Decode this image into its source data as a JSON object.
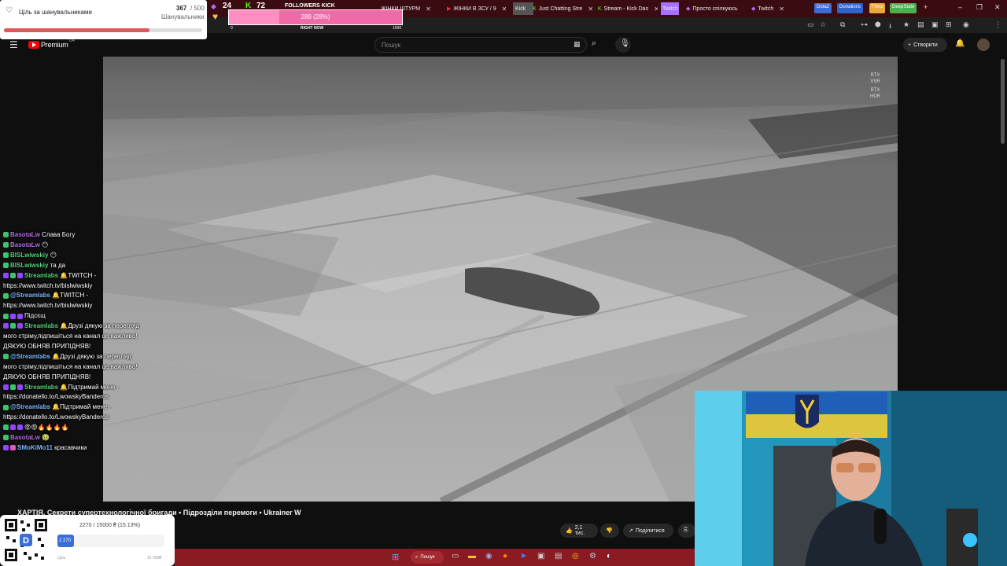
{
  "browser": {
    "tabs": [
      {
        "label": "ЖІНКИ ШТУРМ"
      },
      {
        "label": "ЖІНКИ В ЗСУ / 9"
      },
      {
        "label": "Kick"
      },
      {
        "label": "Just Chatting Stre"
      },
      {
        "label": "Stream - Kick Das"
      },
      {
        "label": "Twitch"
      },
      {
        "label": "Просто спілкуюсь"
      },
      {
        "label": "Twitch"
      }
    ],
    "bookmarks": [
      {
        "label": "Dota2",
        "color": "#3b6ed4"
      },
      {
        "label": "Donations",
        "color": "#2f63c9"
      },
      {
        "label": "Films",
        "color": "#e8a83a"
      },
      {
        "label": "DeepState",
        "color": "#4caf50"
      }
    ],
    "window_controls": [
      "–",
      "❐",
      "✕"
    ],
    "new_tab": "+"
  },
  "youtube": {
    "logo_text": "Premium",
    "logo_sup": "UA",
    "search_placeholder": "Пошук",
    "create_label": "Створити",
    "video_title": "ХАРТІЯ. Секрети супертехнологічної бригади • Підрозділи перемоги • Ukrainer W",
    "likes": "2,1 тис.",
    "share_label": "Поділитися",
    "video_badges": [
      "RTX",
      "VSR",
      "RTX",
      "HDR"
    ]
  },
  "overlays": {
    "goal_title": "Ціль за шанувальниками",
    "goal_count": "367",
    "goal_total": "/ 500",
    "goal_sub": "Шанувальники",
    "goal_fraction": 0.734,
    "stat1": "24",
    "stat2": "72",
    "followers_title": "FOLLOWERS KICK",
    "followers_progress": "289 (28%)",
    "followers_fraction": 0.289,
    "followers_left": "0",
    "followers_mid": "RIGHT NOW",
    "followers_right": "1000",
    "donate_text": "2270 / 15000 ₴ (15.13%)",
    "donate_bar_label": "2 270",
    "donate_fraction": 0.1513,
    "donate_left": "Ціль",
    "donate_right": "15 000₴"
  },
  "chat": [
    {
      "nick": "BasotaLw",
      "nick_class": "nick-p",
      "text": "Слава Богу",
      "badges": [
        "#3ec46d"
      ]
    },
    {
      "nick": "BasotaLw",
      "nick_class": "nick-p",
      "text": "😶",
      "badges": [
        "#3ec46d"
      ]
    },
    {
      "nick": "BISLwiwskiy",
      "nick_class": "nick-g",
      "text": "😶",
      "badges": [
        "#3ec46d"
      ]
    },
    {
      "nick": "BISLwiwskiy",
      "nick_class": "nick-g",
      "text": "та да",
      "badges": [
        "#3ec46d"
      ]
    },
    {
      "nick": "Streamlabs",
      "nick_class": "nick-g",
      "text": "🔔TWITCH -",
      "badges": [
        "#9146ff",
        "#3ec46d",
        "#9146ff"
      ]
    },
    {
      "nick": "",
      "nick_class": "",
      "text": "https://www.twitch.tv/bislwiwskiy",
      "badges": []
    },
    {
      "nick": "@Streamlabs",
      "nick_class": "nick-b",
      "text": "🔔TWITCH -",
      "badges": [
        "#3ec46d"
      ]
    },
    {
      "nick": "",
      "nick_class": "",
      "text": "https://www.twitch.tv/bislwiwskiy",
      "badges": []
    },
    {
      "nick": "",
      "nick_class": "nick-p",
      "text": "Підсєщ",
      "badges": [
        "#3ec46d",
        "#9146ff",
        "#9146ff"
      ]
    },
    {
      "nick": "Streamlabs",
      "nick_class": "nick-g",
      "text": "🔔Друзі дякую за перегляд",
      "badges": [
        "#9146ff",
        "#3ec46d",
        "#9146ff"
      ]
    },
    {
      "nick": "",
      "nick_class": "",
      "text": "мого стріму,підпишіться на канал це важливо!",
      "badges": []
    },
    {
      "nick": "",
      "nick_class": "",
      "text": "ДЯКУЮ ОБНЯВ ПРИПІДНЯВ!",
      "badges": []
    },
    {
      "nick": "@Streamlabs",
      "nick_class": "nick-b",
      "text": "🔔Друзі дякую за перегляд",
      "badges": [
        "#3ec46d"
      ]
    },
    {
      "nick": "",
      "nick_class": "",
      "text": "мого стріму,підпишіться на канал це важливо!",
      "badges": []
    },
    {
      "nick": "",
      "nick_class": "",
      "text": "ДЯКУЮ ОБНЯВ ПРИПІДНЯВ!",
      "badges": []
    },
    {
      "nick": "Streamlabs",
      "nick_class": "nick-g",
      "text": "🔔Підтримай мене -",
      "badges": [
        "#9146ff",
        "#3ec46d",
        "#9146ff"
      ]
    },
    {
      "nick": "",
      "nick_class": "",
      "text": "https://donatello.to/LwowskyBanderos",
      "badges": []
    },
    {
      "nick": "@Streamlabs",
      "nick_class": "nick-b",
      "text": "🔔Підтримай мене -",
      "badges": [
        "#3ec46d"
      ]
    },
    {
      "nick": "",
      "nick_class": "",
      "text": "https://donatello.to/LwowskyBanderos",
      "badges": []
    },
    {
      "nick": "",
      "nick_class": "nick-p",
      "text": "😡😡🔥🔥🔥🔥",
      "badges": [
        "#3ec46d",
        "#9146ff",
        "#9146ff"
      ]
    },
    {
      "nick": "BasotaLw",
      "nick_class": "nick-p",
      "text": "🤢",
      "badges": [
        "#3ec46d"
      ]
    },
    {
      "nick": "SMoKiMo11",
      "nick_class": "nick-b",
      "text": "красавчики",
      "badges": [
        "#9146ff",
        "#e05ab4"
      ]
    }
  ],
  "taskbar": {
    "search_label": "Пошук"
  }
}
